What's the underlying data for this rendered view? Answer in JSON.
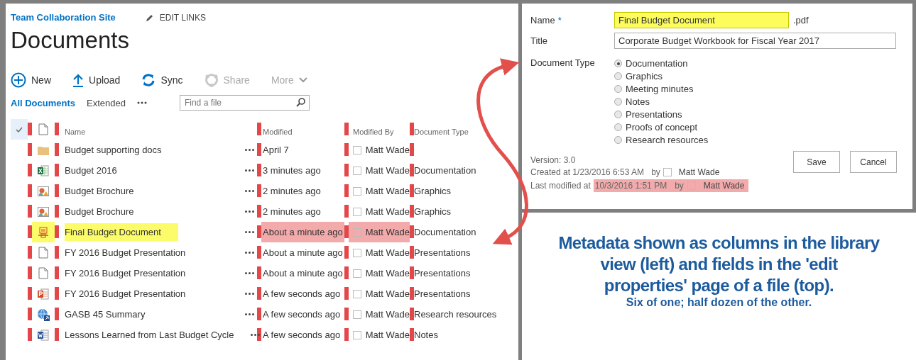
{
  "site": {
    "title": "Team Collaboration Site",
    "edit_links": "EDIT LINKS"
  },
  "page_title": "Documents",
  "commands": [
    {
      "label": "New",
      "kind": "new",
      "disabled": false
    },
    {
      "label": "Upload",
      "kind": "upload",
      "disabled": false
    },
    {
      "label": "Sync",
      "kind": "sync",
      "disabled": false
    },
    {
      "label": "Share",
      "kind": "share",
      "disabled": true
    },
    {
      "label": "More",
      "kind": "more",
      "disabled": true
    }
  ],
  "views": [
    {
      "label": "All Documents",
      "selected": true
    },
    {
      "label": "Extended",
      "selected": false
    }
  ],
  "search": {
    "placeholder": "Find a file"
  },
  "table": {
    "columns": [
      "Name",
      "Modified",
      "Modified By",
      "Document Type"
    ],
    "rows": [
      {
        "kind": "folder",
        "name": "Budget supporting docs",
        "modified": "April 7",
        "modified_by": "Matt Wade",
        "name_highlighted": false,
        "modified_highlighted": false
      },
      {
        "kind": "excel",
        "name": "Budget 2016",
        "modified": "3 minutes ago",
        "modified_by": "Matt Wade",
        "document_type": "Documentation",
        "name_highlighted": false,
        "modified_highlighted": false
      },
      {
        "kind": "image",
        "name": "Budget Brochure",
        "modified": "2 minutes ago",
        "modified_by": "Matt Wade",
        "document_type": "Graphics",
        "name_highlighted": false,
        "modified_highlighted": false
      },
      {
        "kind": "image",
        "name": "Budget Brochure",
        "modified": "2 minutes ago",
        "modified_by": "Matt Wade",
        "document_type": "Graphics",
        "name_highlighted": false,
        "modified_highlighted": false
      },
      {
        "kind": "pdf",
        "name": "Final Budget Document",
        "modified": "About a minute ago",
        "modified_by": "Matt Wade",
        "document_type": "Documentation",
        "name_highlighted": true,
        "modified_highlighted": true
      },
      {
        "kind": "file",
        "name": "FY 2016 Budget Presentation",
        "modified": "About a minute ago",
        "modified_by": "Matt Wade",
        "document_type": "Presentations",
        "name_highlighted": false,
        "modified_highlighted": false
      },
      {
        "kind": "file",
        "name": "FY 2016 Budget Presentation",
        "modified": "About a minute ago",
        "modified_by": "Matt Wade",
        "document_type": "Presentations",
        "name_highlighted": false,
        "modified_highlighted": false
      },
      {
        "kind": "powerpoint",
        "name": "FY 2016 Budget Presentation",
        "modified": "A few seconds ago",
        "modified_by": "Matt Wade",
        "document_type": "Presentations",
        "name_highlighted": false,
        "modified_highlighted": false
      },
      {
        "kind": "web",
        "name": "GASB 45 Summary",
        "modified": "A few seconds ago",
        "modified_by": "Matt Wade",
        "document_type": "Research resources",
        "name_highlighted": false,
        "modified_highlighted": false
      },
      {
        "kind": "word",
        "name": "Lessons Learned from Last Budget Cycle",
        "modified": "A few seconds ago",
        "modified_by": "Matt Wade",
        "document_type": "Notes",
        "name_highlighted": false,
        "modified_highlighted": false
      }
    ]
  },
  "form": {
    "name": {
      "label": "Name",
      "required_mark": "*",
      "value": "Final Budget Document",
      "extension": ".pdf",
      "highlighted": true
    },
    "title": {
      "label": "Title",
      "value": "Corporate Budget Workbook for Fiscal Year 2017"
    },
    "document_type": {
      "label": "Document Type",
      "options": [
        {
          "label": "Documentation",
          "selected": true
        },
        {
          "label": "Graphics",
          "selected": false
        },
        {
          "label": "Meeting minutes",
          "selected": false
        },
        {
          "label": "Notes",
          "selected": false
        },
        {
          "label": "Presentations",
          "selected": false
        },
        {
          "label": "Proofs of concept",
          "selected": false
        },
        {
          "label": "Research resources",
          "selected": false
        }
      ]
    },
    "version": "Version: 3.0",
    "created": {
      "prefix": "Created at 1/23/2016 6:53 AM",
      "by": "by",
      "user": "Matt Wade"
    },
    "modified": {
      "prefix": "Last modified at",
      "date": "10/3/2016 1:51 PM",
      "by": "by",
      "user": "Matt Wade",
      "highlighted": true
    },
    "buttons": [
      "Save",
      "Cancel"
    ]
  },
  "caption": {
    "headline": "Metadata shown as columns in the library view (left) and fields in the 'edit properties' page of a file (top).",
    "subline": "Six of one; half dozen of the other."
  }
}
